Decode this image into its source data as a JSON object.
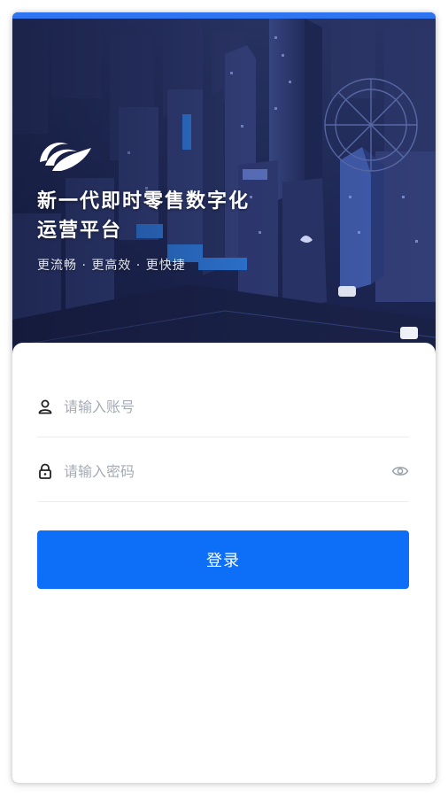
{
  "hero": {
    "headline_line1": "新一代即时零售数字化",
    "headline_line2": "运营平台",
    "tagline": "更流畅 · 更高效 · 更快捷",
    "logo_icon": "wave-logo-icon"
  },
  "form": {
    "account": {
      "placeholder": "请输入账号",
      "value": "",
      "icon": "user-icon"
    },
    "password": {
      "placeholder": "请输入密码",
      "value": "",
      "icon": "lock-icon",
      "toggle_icon": "eye-icon"
    },
    "login_label": "登录"
  },
  "colors": {
    "accent": "#0d6ef8",
    "top_strip": "#2f74f0",
    "hero_bg": "#1d2650",
    "placeholder": "#a6abb5"
  }
}
